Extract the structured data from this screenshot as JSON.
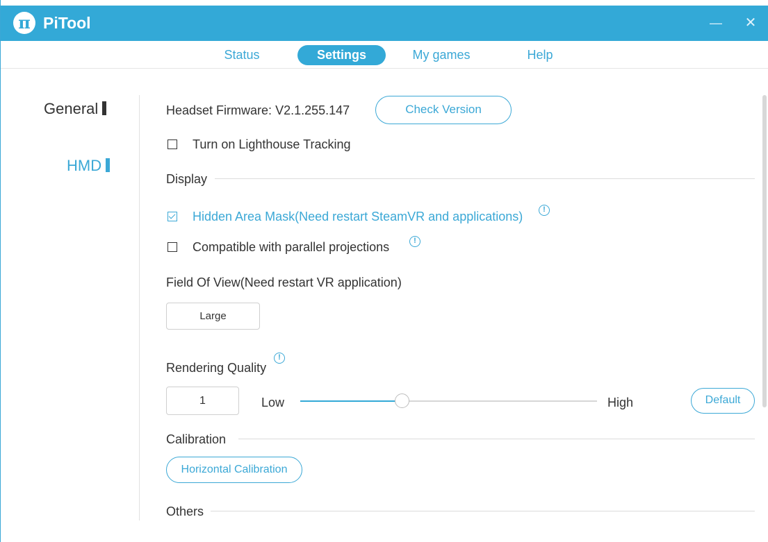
{
  "app": {
    "title": "PiTool",
    "logo_glyph": "π"
  },
  "window_controls": {
    "minimize": "—",
    "close": "✕"
  },
  "tabs": [
    {
      "label": "Status",
      "active": false
    },
    {
      "label": "Settings",
      "active": true
    },
    {
      "label": "My games",
      "active": false
    },
    {
      "label": "Help",
      "active": false
    }
  ],
  "sidebar": {
    "items": [
      {
        "label": "General",
        "active": false
      },
      {
        "label": "HMD",
        "active": true
      }
    ]
  },
  "firmware": {
    "label": "Headset Firmware:",
    "value": "V2.1.255.147",
    "check_button": "Check Version"
  },
  "lighthouse": {
    "label": "Turn on Lighthouse Tracking",
    "checked": false
  },
  "display": {
    "section_title": "Display",
    "hidden_area_mask": {
      "label": "Hidden Area Mask(Need restart SteamVR and applications)",
      "checked": true
    },
    "parallel_projections": {
      "label": "Compatible with parallel projections",
      "checked": false
    },
    "fov": {
      "label": "Field Of View(Need restart VR application)",
      "selected": "Large"
    }
  },
  "rendering": {
    "label": "Rendering Quality",
    "value": "1",
    "low_label": "Low",
    "high_label": "High",
    "slider_fraction": 0.342,
    "default_button": "Default"
  },
  "calibration": {
    "section_title": "Calibration",
    "button": "Horizontal Calibration"
  },
  "others": {
    "section_title": "Others"
  },
  "colors": {
    "accent": "#33a9d7",
    "text": "#333333",
    "divider": "#dcdcdc"
  },
  "icons": {
    "info": "info-icon",
    "check": "checkbox-checked-icon"
  }
}
